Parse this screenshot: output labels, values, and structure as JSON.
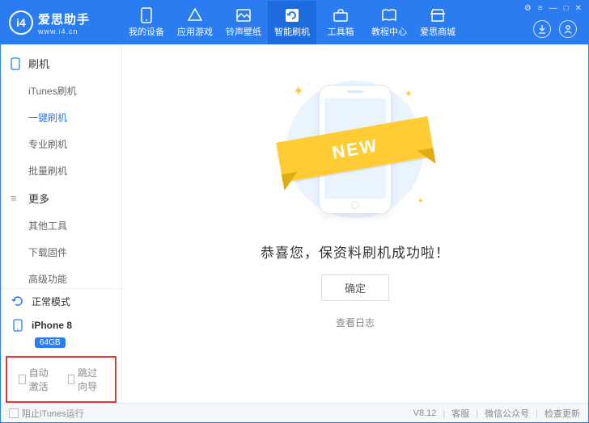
{
  "app": {
    "name_cn": "爱思助手",
    "url": "www.i4.cn",
    "logo_text": "i4"
  },
  "nav": {
    "items": [
      {
        "label": "我的设备"
      },
      {
        "label": "应用游戏"
      },
      {
        "label": "铃声壁纸"
      },
      {
        "label": "智能刷机"
      },
      {
        "label": "工具箱"
      },
      {
        "label": "教程中心"
      },
      {
        "label": "爱思商城"
      }
    ],
    "active_index": 3
  },
  "sidebar": {
    "sections": [
      {
        "title": "刷机",
        "items": [
          "iTunes刷机",
          "一键刷机",
          "专业刷机",
          "批量刷机"
        ],
        "active_index": 1
      },
      {
        "title": "更多",
        "items": [
          "其他工具",
          "下载固件",
          "高级功能"
        ]
      }
    ],
    "mode": {
      "label": "正常模式"
    },
    "device": {
      "name": "iPhone 8",
      "storage": "64GB"
    },
    "checks": {
      "auto_activate": "自动激活",
      "skip_guide": "跳过向导"
    }
  },
  "main": {
    "ribbon": "NEW",
    "message": "恭喜您，保资料刷机成功啦！",
    "ok": "确定",
    "log": "查看日志"
  },
  "footer": {
    "block_itunes": "阻止iTunes运行",
    "version": "V8.12",
    "support": "客服",
    "wechat": "微信公众号",
    "check_update": "检查更新"
  }
}
